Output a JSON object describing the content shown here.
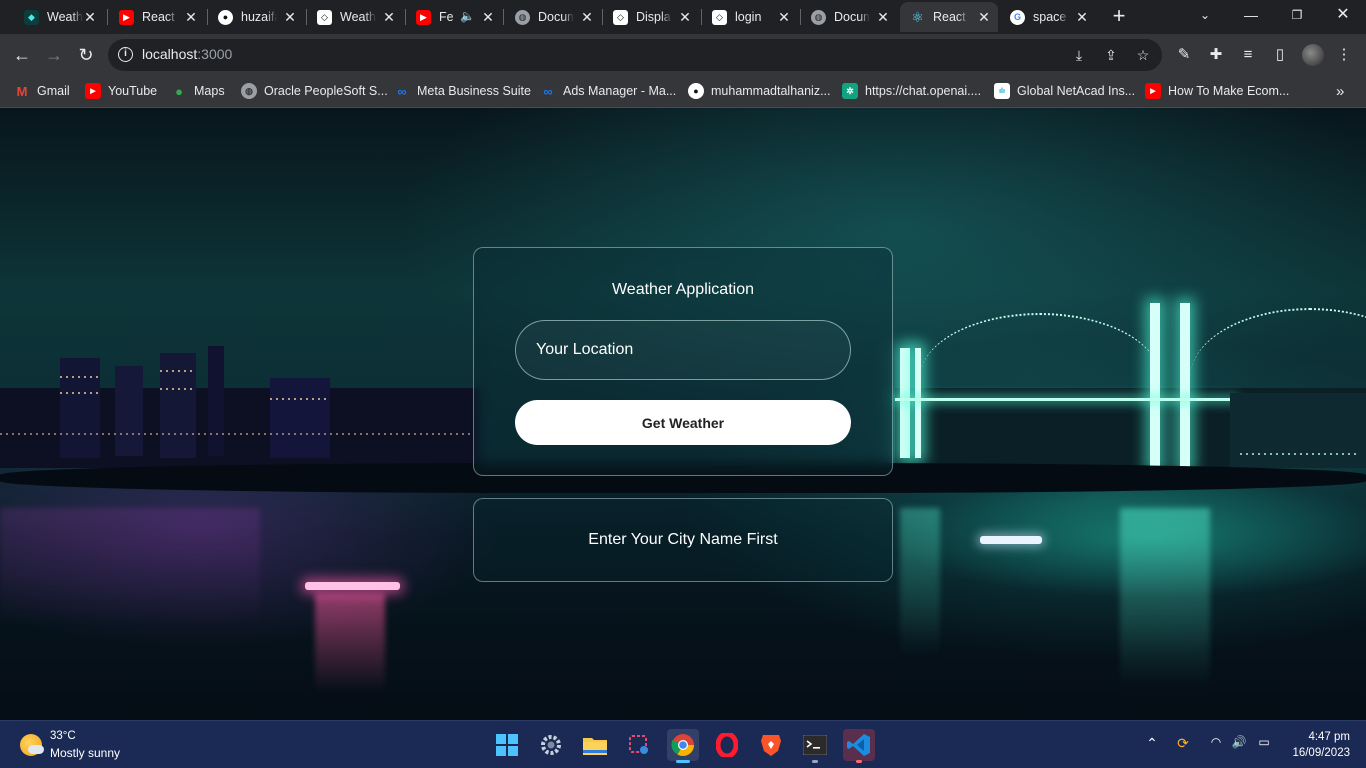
{
  "browser": {
    "tabs": [
      {
        "label": "Weath",
        "icon": "weather-app-icon",
        "color": "#1e1e1e",
        "active": false
      },
      {
        "label": "React",
        "icon": "youtube-icon",
        "color": "#ff0000",
        "active": false
      },
      {
        "label": "huzaifa",
        "icon": "github-icon",
        "color": "#ffffff",
        "active": false
      },
      {
        "label": "Weath",
        "icon": "codepen-icon",
        "color": "#ffffff",
        "active": false
      },
      {
        "label": "Fe",
        "icon": "youtube-icon",
        "color": "#ff0000",
        "active": false
      },
      {
        "label": "Docum",
        "icon": "globe-icon",
        "color": "#9aa0a6",
        "active": false
      },
      {
        "label": "Displa",
        "icon": "codepen-icon",
        "color": "#ffffff",
        "active": false
      },
      {
        "label": "login",
        "icon": "codepen-icon",
        "color": "#ffffff",
        "active": false
      },
      {
        "label": "Docum",
        "icon": "globe-icon",
        "color": "#9aa0a6",
        "active": false
      },
      {
        "label": "React",
        "icon": "react-icon",
        "color": "#61dafb",
        "active": true
      },
      {
        "label": "space",
        "icon": "google-icon",
        "color": "#ffffff",
        "active": false
      }
    ],
    "url_host": "localhost",
    "url_port": ":3000",
    "bookmarks": [
      {
        "label": "Gmail",
        "icon": "gmail-icon",
        "color": "#ea4335"
      },
      {
        "label": "YouTube",
        "icon": "youtube-icon",
        "color": "#ff0000"
      },
      {
        "label": "Maps",
        "icon": "maps-icon",
        "color": "#34a853"
      },
      {
        "label": "Oracle PeopleSoft S...",
        "icon": "globe-icon",
        "color": "#9aa0a6"
      },
      {
        "label": "Meta Business Suite",
        "icon": "meta-icon",
        "color": "#1877f2"
      },
      {
        "label": "Ads Manager - Ma...",
        "icon": "meta-icon",
        "color": "#1877f2"
      },
      {
        "label": "muhammadtalhaniz...",
        "icon": "github-icon",
        "color": "#ffffff"
      },
      {
        "label": "https://chat.openai....",
        "icon": "openai-icon",
        "color": "#10a37f"
      },
      {
        "label": "Global NetAcad Ins...",
        "icon": "cisco-icon",
        "color": "#049fd9"
      },
      {
        "label": "How To Make Ecom...",
        "icon": "youtube-icon",
        "color": "#ff0000"
      }
    ]
  },
  "app": {
    "title": "Weather Application",
    "location_placeholder": "Your Location",
    "location_value": "",
    "button_label": "Get Weather",
    "message": "Enter Your City Name First"
  },
  "taskbar": {
    "weather_temp": "33°C",
    "weather_desc": "Mostly sunny",
    "time": "4:47 pm",
    "date": "16/09/2023",
    "apps": [
      "windows-start-icon",
      "settings-icon",
      "file-explorer-icon",
      "snipping-tool-icon",
      "chrome-icon",
      "opera-icon",
      "brave-icon",
      "terminal-icon",
      "vscode-icon"
    ]
  }
}
